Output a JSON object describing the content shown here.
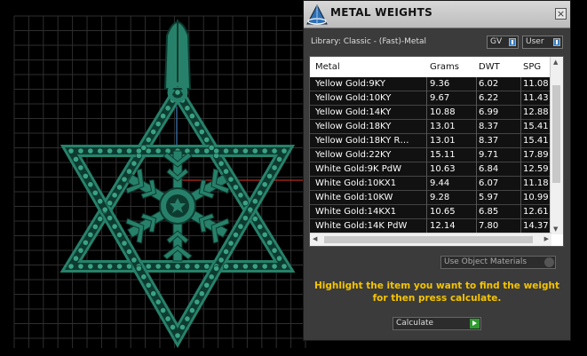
{
  "panel": {
    "title": "METAL WEIGHTS",
    "close_label": "×",
    "library_label": "Library: Classic - (Fast)-Metal",
    "gv_label": "GV",
    "user_label": "User",
    "columns": [
      "Metal",
      "Grams",
      "DWT",
      "SPG"
    ],
    "rows": [
      [
        "Yellow Gold:9KY",
        "9.36",
        "6.02",
        "11.08"
      ],
      [
        "Yellow Gold:10KY",
        "9.67",
        "6.22",
        "11.43"
      ],
      [
        "Yellow Gold:14KY",
        "10.88",
        "6.99",
        "12.88"
      ],
      [
        "Yellow Gold:18KY",
        "13.01",
        "8.37",
        "15.41"
      ],
      [
        "Yellow Gold:18KY R…",
        "13.01",
        "8.37",
        "15.41"
      ],
      [
        "Yellow Gold:22KY",
        "15.11",
        "9.71",
        "17.89"
      ],
      [
        "White Gold:9K PdW",
        "10.63",
        "6.84",
        "12.59"
      ],
      [
        "White Gold:10KX1",
        "9.44",
        "6.07",
        "11.18"
      ],
      [
        "White Gold:10KW",
        "9.28",
        "5.97",
        "10.99"
      ],
      [
        "White Gold:14KX1",
        "10.65",
        "6.85",
        "12.61"
      ],
      [
        "White Gold:14K PdW",
        "12.14",
        "7.80",
        "14.37"
      ]
    ],
    "materials_dropdown": "Use Object Materials",
    "hint_line1": "Highlight the item you want to find the weight",
    "hint_line2": "for then press calculate.",
    "calculate_label": "Calculate"
  },
  "colors": {
    "pendant": "#27816a",
    "grid": "#2e2e2e",
    "hint": "#f5c400"
  }
}
